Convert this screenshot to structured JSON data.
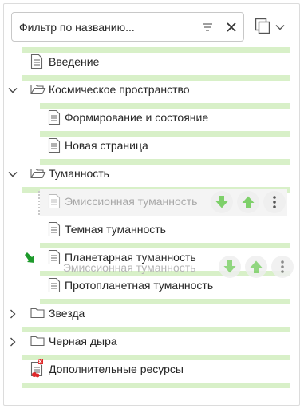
{
  "filter": {
    "placeholder": "Фильтр по названию..."
  },
  "tree": {
    "items": [
      {
        "label": "Введение"
      },
      {
        "label": "Космическое пространство"
      },
      {
        "label": "Формирование и состояние"
      },
      {
        "label": "Новая страница"
      },
      {
        "label": "Туманность"
      },
      {
        "label": "Эмиссионная туманность"
      },
      {
        "label": "Темная туманность"
      },
      {
        "label": "Планетарная туманность"
      },
      {
        "label": "Протопланетная туманность"
      },
      {
        "label": "Звезда"
      },
      {
        "label": "Черная дыра"
      },
      {
        "label": "Дополнительные ресурсы"
      }
    ],
    "drag_preview": {
      "label": "Эмиссионная туманность"
    }
  },
  "colors": {
    "drop_line": "#d8f0c8",
    "move_button_green": "#7ed06a",
    "drop_arrow_green": "#1e9a2c",
    "error_red": "#e0282a"
  },
  "icons": {
    "filter": "filter-icon",
    "clear": "close-icon",
    "view": "copy-pages-icon",
    "page": "page-icon",
    "folder": "folder-icon",
    "folder_open": "folder-open-icon",
    "move_down": "arrow-down-icon",
    "move_up": "arrow-up-icon",
    "more": "more-vertical-icon",
    "drop_indicator": "drop-arrow-icon",
    "error_page": "page-error-icon"
  }
}
